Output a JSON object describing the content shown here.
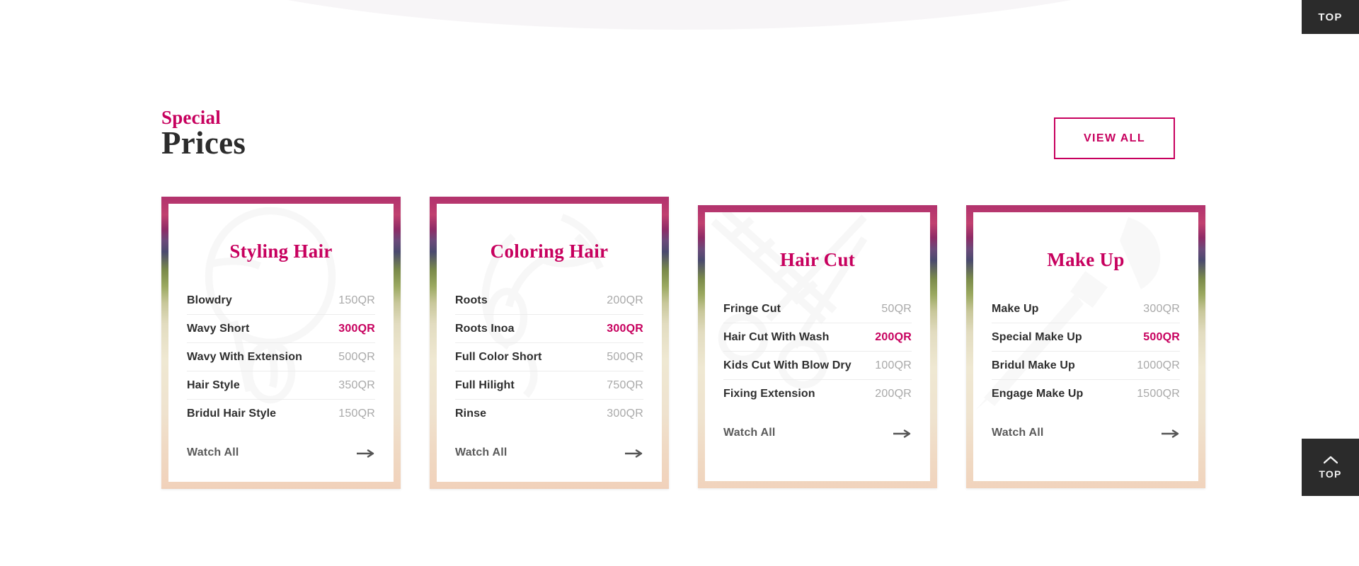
{
  "overlays": {
    "top_tab_label": "TOP",
    "scroll_top_label": "TOP",
    "scroll_top_icon": "chevron-up-icon"
  },
  "section": {
    "kicker": "Special",
    "title": "Prices",
    "view_all_label": "VIEW ALL"
  },
  "colors": {
    "accent_pink": "#c7005e",
    "title_dark": "#2c2c2c",
    "price_muted": "#a9a9a9",
    "dark_button": "#2b2b2b"
  },
  "cards": [
    {
      "title": "Styling Hair",
      "watermark_icon": "hair-dryer-icon",
      "size": "tall",
      "rows": [
        {
          "name": "Blowdry",
          "price": "150QR",
          "highlight": false
        },
        {
          "name": "Wavy Short",
          "price": "300QR",
          "highlight": true
        },
        {
          "name": "Wavy With Extension",
          "price": "500QR",
          "highlight": false
        },
        {
          "name": "Hair Style",
          "price": "350QR",
          "highlight": false
        },
        {
          "name": "Bridul Hair Style",
          "price": "150QR",
          "highlight": false
        }
      ],
      "footer_label": "Watch All",
      "footer_icon": "arrow-right-icon"
    },
    {
      "title": "Coloring Hair",
      "watermark_icon": "hair-color-brush-icon",
      "size": "tall",
      "rows": [
        {
          "name": "Roots",
          "price": "200QR",
          "highlight": false
        },
        {
          "name": "Roots Inoa",
          "price": "300QR",
          "highlight": true
        },
        {
          "name": "Full Color Short",
          "price": "500QR",
          "highlight": false
        },
        {
          "name": "Full Hilight",
          "price": "750QR",
          "highlight": false
        },
        {
          "name": "Rinse",
          "price": "300QR",
          "highlight": false
        }
      ],
      "footer_label": "Watch All",
      "footer_icon": "arrow-right-icon"
    },
    {
      "title": "Hair Cut",
      "watermark_icon": "comb-scissors-icon",
      "size": "short",
      "rows": [
        {
          "name": "Fringe Cut",
          "price": "50QR",
          "highlight": false
        },
        {
          "name": "Hair Cut With Wash",
          "price": "200QR",
          "highlight": true
        },
        {
          "name": "Kids Cut With Blow Dry",
          "price": "100QR",
          "highlight": false
        },
        {
          "name": "Fixing Extension",
          "price": "200QR",
          "highlight": false
        }
      ],
      "footer_label": "Watch All",
      "footer_icon": "arrow-right-icon"
    },
    {
      "title": "Make Up",
      "watermark_icon": "makeup-brush-icon",
      "size": "short",
      "rows": [
        {
          "name": "Make Up",
          "price": "300QR",
          "highlight": false
        },
        {
          "name": "Special Make Up",
          "price": "500QR",
          "highlight": true
        },
        {
          "name": "Bridul Make Up",
          "price": "1000QR",
          "highlight": false
        },
        {
          "name": "Engage Make Up",
          "price": "1500QR",
          "highlight": false
        }
      ],
      "footer_label": "Watch All",
      "footer_icon": "arrow-right-icon"
    }
  ]
}
